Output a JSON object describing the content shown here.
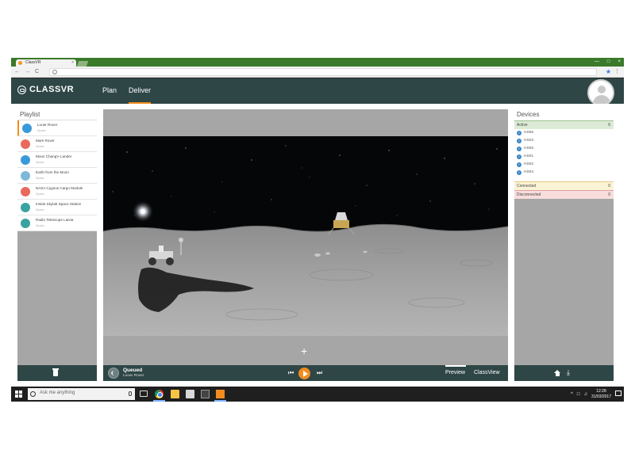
{
  "browser": {
    "tab_title": "ClassVR",
    "tab_close": "×",
    "window_controls": [
      "—",
      "□",
      "×"
    ],
    "nav": [
      "←",
      "→",
      "C"
    ],
    "info": "i",
    "star": "★",
    "menu": "⋮"
  },
  "app": {
    "logo": "CLASSVR",
    "tabs": [
      {
        "label": "Plan"
      },
      {
        "label": "Deliver"
      }
    ]
  },
  "playlist": {
    "heading": "Playlist",
    "items": [
      {
        "title": "Lunar Rover",
        "category": "Space",
        "icon_color": "#3a9ad9",
        "icon": "moon-icon"
      },
      {
        "title": "Mars Rover",
        "category": "Space",
        "icon_color": "#e86a5c",
        "icon": "rocket-icon"
      },
      {
        "title": "Moon Chang'e Lander",
        "category": "Space",
        "icon_color": "#3a9ad9",
        "icon": "moon-icon"
      },
      {
        "title": "Earth from the Moon",
        "category": "Space",
        "icon_color": "#7fb8d9",
        "icon": "earth-icon"
      },
      {
        "title": "NASA Cygnus Cargo Module",
        "category": "Space",
        "icon_color": "#e86a5c",
        "icon": "rocket-icon"
      },
      {
        "title": "Inside Skylab Space Station",
        "category": "Space",
        "icon_color": "#3aa3a0",
        "icon": "satellite-icon"
      },
      {
        "title": "Radio Telescope Latvia",
        "category": "Space",
        "icon_color": "#3aa3a0",
        "icon": "satellite-icon"
      }
    ]
  },
  "player": {
    "status": "Queued",
    "current_title": "Lunar Rover",
    "prev": "⏮",
    "next": "⏭",
    "crosshair": "+",
    "view_tabs": [
      {
        "label": "Preview"
      },
      {
        "label": "ClassView"
      }
    ]
  },
  "devices": {
    "heading": "Devices",
    "groups": {
      "active": {
        "label": "Active",
        "count": "6"
      },
      "connected": {
        "label": "Connected",
        "count": "0"
      },
      "disconnected": {
        "label": "Disconnected",
        "count": "0"
      }
    },
    "list": [
      "HS06",
      "HS03",
      "HS05",
      "HS01",
      "HS02",
      "HS04"
    ],
    "download": "⤓"
  },
  "taskbar": {
    "search_placeholder": "Ask me anything",
    "tray": "^",
    "time": "12:28",
    "date": "31/03/2017"
  },
  "colors": {
    "header": "#2f4646",
    "accent": "#f28c1e",
    "active_group": "#dcebd6",
    "connected_group": "#fbf3d5",
    "disconnected_group": "#f8dddd"
  }
}
